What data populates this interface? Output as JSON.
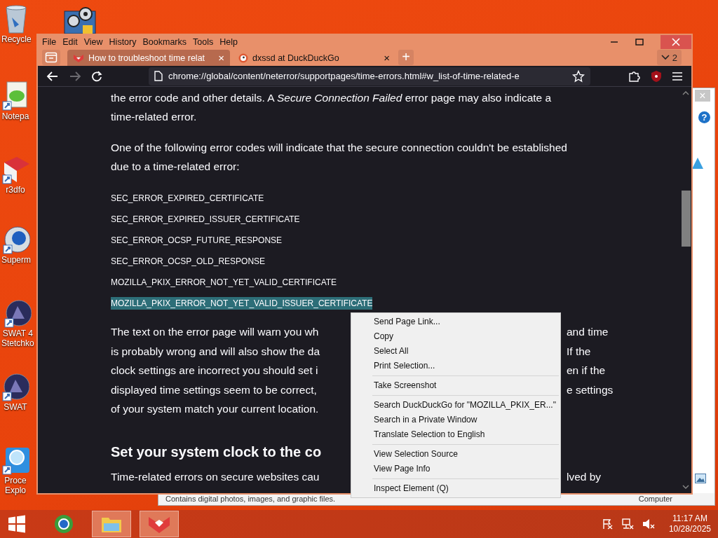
{
  "desktop_icons": [
    {
      "kind": "recycle-bin",
      "lines": [
        "Recycle"
      ]
    },
    {
      "kind": "gears"
    },
    {
      "kind": "notepad",
      "lines": [
        "Notepa"
      ]
    },
    {
      "kind": "cube",
      "lines": [
        "r3dfo"
      ]
    },
    {
      "kind": "globe",
      "lines": [
        "Superm"
      ]
    },
    {
      "kind": "emblem",
      "lines": [
        "SWAT 4",
        "Stetchko"
      ]
    },
    {
      "kind": "emblem",
      "lines": [
        "SWAT"
      ]
    },
    {
      "kind": "magnifier",
      "lines": [
        "Proce",
        "Explo"
      ]
    }
  ],
  "background_window": {
    "close": "×",
    "help": "?",
    "status_text": "Contains digital photos, images, and graphic files.",
    "location": "Computer"
  },
  "browser": {
    "menu": [
      {
        "label": "File"
      },
      {
        "label": "Edit"
      },
      {
        "label": "View"
      },
      {
        "label": "History"
      },
      {
        "label": "Bookmarks"
      },
      {
        "label": "Tools"
      },
      {
        "label": "Help"
      }
    ],
    "tabs": [
      {
        "title": "How to troubleshoot time relat",
        "selected": true,
        "close": "×"
      },
      {
        "title": "dxssd at DuckDuckGo",
        "selected": false,
        "close": "×"
      }
    ],
    "new_tab": "+",
    "tab_count": "2",
    "url": "chrome://global/content/neterror/supportpages/time-errors.html#w_list-of-time-related-e",
    "content": {
      "intro": "the error code and other details. A *Secure Connection Failed* error page may also indicate a time-related error.",
      "codes_intro": "One of the following error codes will indicate that the secure connection couldn't be established due to a time-related error:",
      "codes": [
        {
          "text": "SEC_ERROR_EXPIRED_CERTIFICATE",
          "selected": false
        },
        {
          "text": "SEC_ERROR_EXPIRED_ISSUER_CERTIFICATE",
          "selected": false
        },
        {
          "text": "SEC_ERROR_OCSP_FUTURE_RESPONSE",
          "selected": false
        },
        {
          "text": "SEC_ERROR_OCSP_OLD_RESPONSE",
          "selected": false
        },
        {
          "text": "MOZILLA_PKIX_ERROR_NOT_YET_VALID_CERTIFICATE",
          "selected": false
        },
        {
          "text": "MOZILLA_PKIX_ERROR_NOT_YET_VALID_ISSUER_CERTIFICATE",
          "selected": true
        }
      ],
      "warning_lines": [
        {
          "left": "The text on the error page will warn you wh",
          "right": "and time"
        },
        {
          "left": "is probably wrong and will also show the da",
          "right": "If the"
        },
        {
          "left": "clock settings are incorrect you should set i",
          "right": "en if the"
        },
        {
          "left": "displayed time settings seem to be correct,",
          "right": "e settings"
        },
        {
          "left": "of your system match your current location."
        }
      ],
      "heading": "Set your system clock to the co",
      "last_line": {
        "left": "Time-related errors on secure websites cau",
        "right": "lved by"
      }
    }
  },
  "context_menu": {
    "groups": [
      [
        {
          "label": "Send Page Link..."
        },
        {
          "label": "Copy"
        },
        {
          "label": "Select All"
        },
        {
          "label": "Print Selection..."
        }
      ],
      [
        {
          "label": "Take Screenshot"
        }
      ],
      [
        {
          "label": "Search DuckDuckGo for \"MOZILLA_PKIX_ER...\""
        },
        {
          "label": "Search in a Private Window"
        },
        {
          "label": "Translate Selection to English"
        }
      ],
      [
        {
          "label": "View Selection Source"
        },
        {
          "label": "View Page Info"
        }
      ],
      [
        {
          "label": "Inspect Element (Q)"
        }
      ]
    ]
  },
  "taskbar": {
    "apps": [
      {
        "kind": "globe",
        "highlighted": false
      },
      {
        "kind": "folder",
        "highlighted": true
      },
      {
        "kind": "fox",
        "highlighted": true
      }
    ],
    "time": "11:17 AM",
    "date": "10/28/2025"
  }
}
